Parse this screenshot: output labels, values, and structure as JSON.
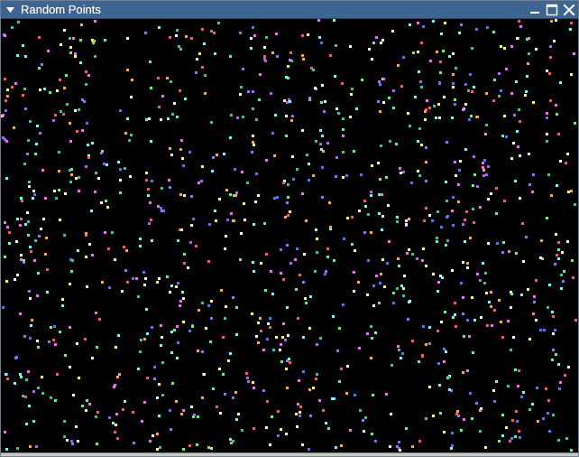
{
  "window": {
    "title": "Random Points"
  },
  "titlebar_icons": {
    "menu": "menu-triangle-icon",
    "minimize": "minimize-icon",
    "maximize": "maximize-icon",
    "close": "close-icon"
  },
  "colors": {
    "titlebar": "#3e6590",
    "canvas_background": "#000000",
    "point_palette": [
      "#ff5566",
      "#55ff77",
      "#5577ff",
      "#ffff66",
      "#ff66ff",
      "#66ffff",
      "#ffffff",
      "#ffaa33",
      "#aa66ff",
      "#33cc99"
    ]
  },
  "points_canvas": {
    "point_count": 1200
  }
}
